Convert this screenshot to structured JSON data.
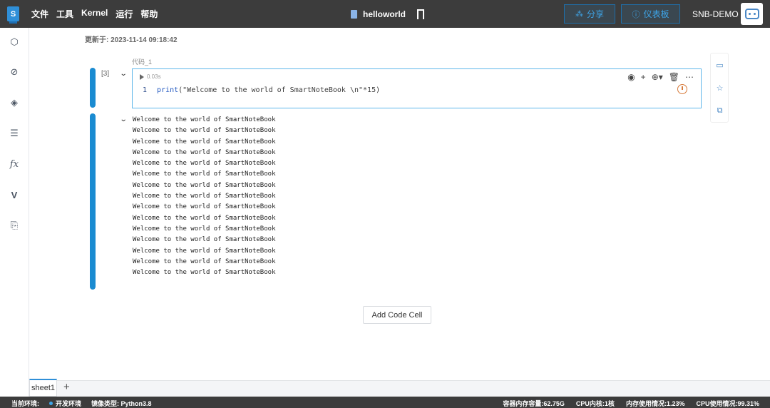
{
  "topbar": {
    "logo": "S",
    "menu": [
      "文件",
      "工具",
      "Kernel",
      "运行",
      "帮助"
    ],
    "doc_title": "helloworld",
    "share_label": "分享",
    "dashboard_label": "仪表板",
    "user_name": "SNB-DEMO"
  },
  "main": {
    "updated_text": "更新于:  2023-11-14 09:18:42",
    "cell": {
      "label": "代码_1",
      "exec_count": "[3]",
      "run_time": "0.03s",
      "line_number": "1",
      "code_fn": "print",
      "code_rest": "(\"Welcome to the world of SmartNoteBook \\n\"*15)"
    },
    "output_lines": [
      "Welcome to the world of SmartNoteBook",
      "Welcome to the world of SmartNoteBook",
      "Welcome to the world of SmartNoteBook",
      "Welcome to the world of SmartNoteBook",
      "Welcome to the world of SmartNoteBook",
      "Welcome to the world of SmartNoteBook",
      "Welcome to the world of SmartNoteBook",
      "Welcome to the world of SmartNoteBook",
      "Welcome to the world of SmartNoteBook",
      "Welcome to the world of SmartNoteBook",
      "Welcome to the world of SmartNoteBook",
      "Welcome to the world of SmartNoteBook",
      "Welcome to the world of SmartNoteBook",
      "Welcome to the world of SmartNoteBook",
      "Welcome to the world of SmartNoteBook"
    ],
    "add_cell_label": "Add Code Cell"
  },
  "sheets": {
    "active": "sheet1",
    "add": "+"
  },
  "statusbar": {
    "env_label": "当前环境:",
    "env_value": "开发环境",
    "image_type": "镜像类型:  Python3.8",
    "memory": "容器内存容量:62.75G",
    "cpu_cores": "CPU内核:1核",
    "mem_usage": "内存使用情况:1.23%",
    "cpu_usage": "CPU使用情况:99.31%"
  },
  "icons": {
    "rail": [
      "cube-icon",
      "paperclip-icon",
      "layers-icon",
      "list-icon",
      "function-icon",
      "variable-icon",
      "file-code-icon"
    ],
    "side": [
      "comment-icon",
      "star-icon",
      "code-panel-icon"
    ]
  },
  "colors": {
    "accent": "#1a8bd1",
    "topbar": "#3c3c3c"
  }
}
